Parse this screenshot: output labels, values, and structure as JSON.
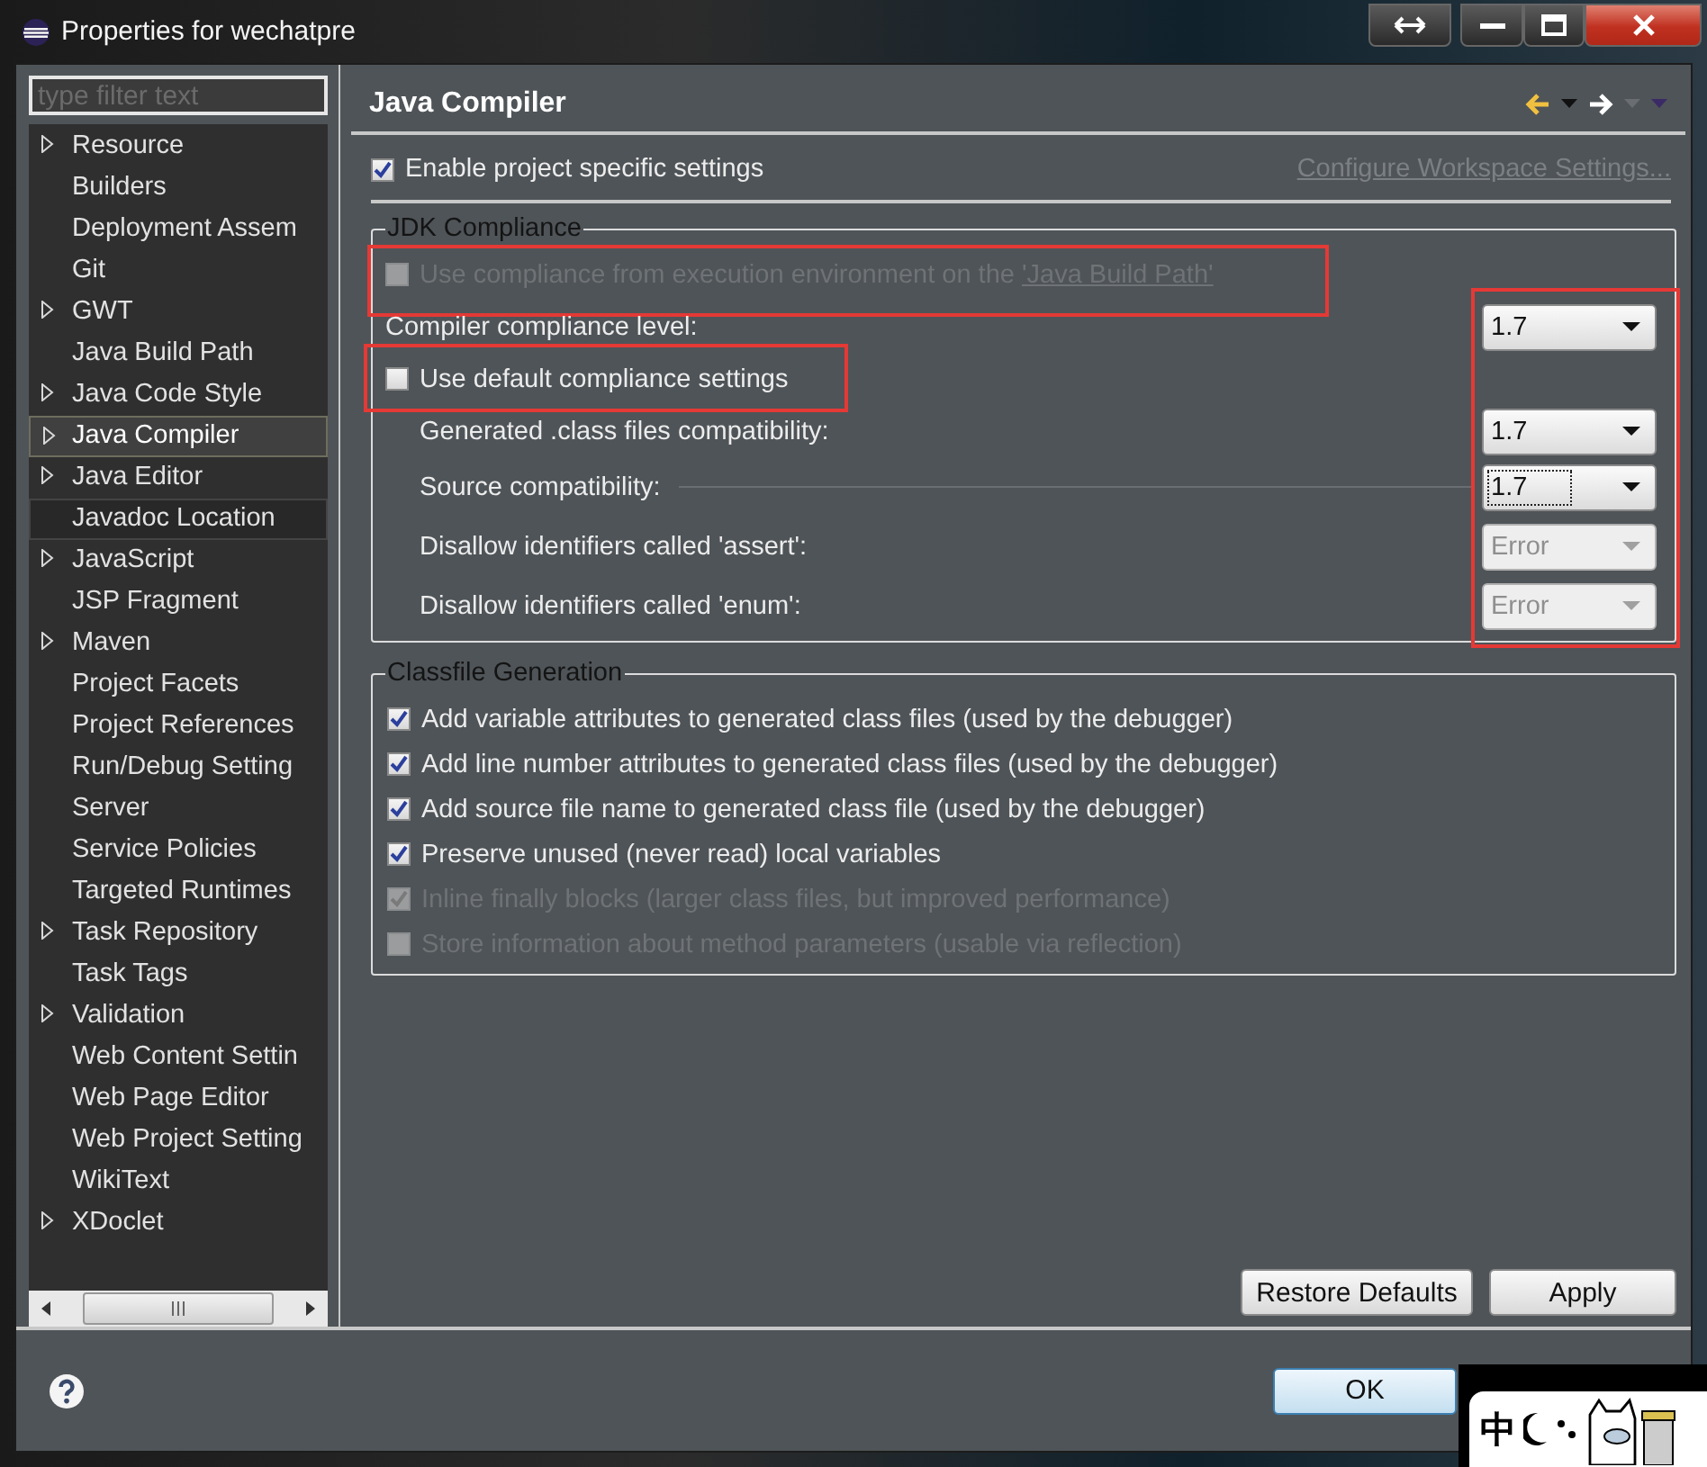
{
  "window": {
    "title": "Properties for wechatpre"
  },
  "filter": {
    "placeholder": "type filter text"
  },
  "sidebar": {
    "items": [
      {
        "label": "Resource",
        "expandable": true,
        "selected": false,
        "hovered": false
      },
      {
        "label": "Builders",
        "expandable": false,
        "selected": false,
        "hovered": false
      },
      {
        "label": "Deployment Assem",
        "expandable": false,
        "selected": false,
        "hovered": false
      },
      {
        "label": "Git",
        "expandable": false,
        "selected": false,
        "hovered": false
      },
      {
        "label": "GWT",
        "expandable": true,
        "selected": false,
        "hovered": false
      },
      {
        "label": "Java Build Path",
        "expandable": false,
        "selected": false,
        "hovered": false
      },
      {
        "label": "Java Code Style",
        "expandable": true,
        "selected": false,
        "hovered": false
      },
      {
        "label": "Java Compiler",
        "expandable": true,
        "selected": true,
        "hovered": false
      },
      {
        "label": "Java Editor",
        "expandable": true,
        "selected": false,
        "hovered": false
      },
      {
        "label": "Javadoc Location",
        "expandable": false,
        "selected": false,
        "hovered": true
      },
      {
        "label": "JavaScript",
        "expandable": true,
        "selected": false,
        "hovered": false
      },
      {
        "label": "JSP Fragment",
        "expandable": false,
        "selected": false,
        "hovered": false
      },
      {
        "label": "Maven",
        "expandable": true,
        "selected": false,
        "hovered": false
      },
      {
        "label": "Project Facets",
        "expandable": false,
        "selected": false,
        "hovered": false
      },
      {
        "label": "Project References",
        "expandable": false,
        "selected": false,
        "hovered": false
      },
      {
        "label": "Run/Debug Setting",
        "expandable": false,
        "selected": false,
        "hovered": false
      },
      {
        "label": "Server",
        "expandable": false,
        "selected": false,
        "hovered": false
      },
      {
        "label": "Service Policies",
        "expandable": false,
        "selected": false,
        "hovered": false
      },
      {
        "label": "Targeted Runtimes",
        "expandable": false,
        "selected": false,
        "hovered": false
      },
      {
        "label": "Task Repository",
        "expandable": true,
        "selected": false,
        "hovered": false
      },
      {
        "label": "Task Tags",
        "expandable": false,
        "selected": false,
        "hovered": false
      },
      {
        "label": "Validation",
        "expandable": true,
        "selected": false,
        "hovered": false
      },
      {
        "label": "Web Content Settin",
        "expandable": false,
        "selected": false,
        "hovered": false
      },
      {
        "label": "Web Page Editor",
        "expandable": false,
        "selected": false,
        "hovered": false
      },
      {
        "label": "Web Project Setting",
        "expandable": false,
        "selected": false,
        "hovered": false
      },
      {
        "label": "WikiText",
        "expandable": false,
        "selected": false,
        "hovered": false
      },
      {
        "label": "XDoclet",
        "expandable": true,
        "selected": false,
        "hovered": false
      }
    ]
  },
  "page": {
    "title": "Java Compiler",
    "enable": {
      "label": "Enable project specific settings",
      "checked": true
    },
    "workspace_link": "Configure Workspace Settings...",
    "jdk": {
      "title": "JDK Compliance",
      "combos_highlighted": true,
      "rows": [
        {
          "kind": "checkbox",
          "label": "Use compliance from execution environment on the ",
          "link": "'Java Build Path'",
          "checked": false,
          "disabled": true,
          "highlighted": true
        },
        {
          "kind": "combo",
          "label": "Compiler compliance level:",
          "value": "1.7",
          "disabled": false,
          "focused": false
        },
        {
          "kind": "checkbox",
          "label": "Use default compliance settings",
          "checked": false,
          "disabled": false,
          "highlighted": true,
          "children": [
            {
              "kind": "combo",
              "label": "Generated .class files compatibility:",
              "value": "1.7",
              "disabled": false,
              "focused": false
            },
            {
              "kind": "combo",
              "label": "Source compatibility:",
              "value": "1.7",
              "disabled": false,
              "focused": true
            },
            {
              "kind": "combo",
              "label": "Disallow identifiers called 'assert':",
              "value": "Error",
              "disabled": true,
              "focused": false
            },
            {
              "kind": "combo",
              "label": "Disallow identifiers called 'enum':",
              "value": "Error",
              "disabled": true,
              "focused": false
            }
          ]
        }
      ]
    },
    "classfile": {
      "title": "Classfile Generation",
      "rows": [
        {
          "label": "Add variable attributes to generated class files (used by the debugger)",
          "checked": true,
          "disabled": false
        },
        {
          "label": "Add line number attributes to generated class files (used by the debugger)",
          "checked": true,
          "disabled": false
        },
        {
          "label": "Add source file name to generated class file (used by the debugger)",
          "checked": true,
          "disabled": false
        },
        {
          "label": "Preserve unused (never read) local variables",
          "checked": true,
          "disabled": false
        },
        {
          "label": "Inline finally blocks (larger class files, but improved performance)",
          "checked": true,
          "disabled": true
        },
        {
          "label": "Store information about method parameters (usable via reflection)",
          "checked": false,
          "disabled": true
        }
      ]
    },
    "buttons": [
      "Restore Defaults",
      "Apply"
    ]
  },
  "footer": {
    "ok": "OK"
  },
  "ime": {
    "label": "中"
  }
}
